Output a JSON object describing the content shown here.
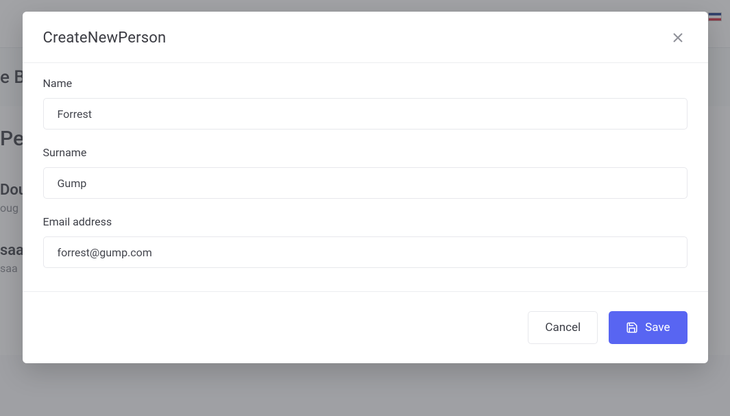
{
  "background": {
    "header_partial": "e B",
    "section_title_partial": "Pe",
    "list": [
      {
        "name_partial": "Dou",
        "email_partial": "oug"
      },
      {
        "name_partial": "saa",
        "email_partial": "saa"
      }
    ]
  },
  "modal": {
    "title": "CreateNewPerson",
    "fields": {
      "name": {
        "label": "Name",
        "value": "Forrest"
      },
      "surname": {
        "label": "Surname",
        "value": "Gump"
      },
      "email": {
        "label": "Email address",
        "value": "forrest@gump.com"
      }
    },
    "buttons": {
      "cancel": "Cancel",
      "save": "Save"
    }
  }
}
